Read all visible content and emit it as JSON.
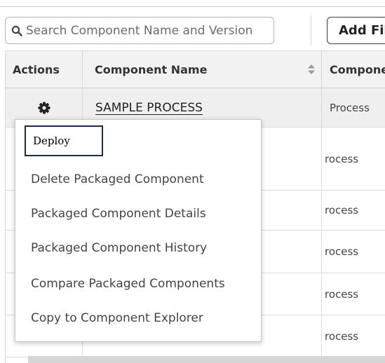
{
  "toolbar": {
    "search_placeholder": "Search Component Name and Version",
    "add_filter_label": "Add Filter"
  },
  "table": {
    "columns": [
      "Actions",
      "Component Name",
      "Component Type"
    ],
    "first_row": {
      "name": "SAMPLE PROCESS",
      "type": "Process"
    },
    "partial_types": [
      "rocess",
      "rocess",
      "rocess",
      "rocess",
      "rocess"
    ]
  },
  "context_menu": {
    "items": [
      "Deploy",
      "Delete Packaged Component",
      "Packaged Component Details",
      "Packaged Component History",
      "Compare Packaged Components",
      "Copy to Component Explorer"
    ]
  },
  "icons": {
    "search": "search-icon",
    "actions": "gear-icon",
    "sort": "sort-icon"
  }
}
